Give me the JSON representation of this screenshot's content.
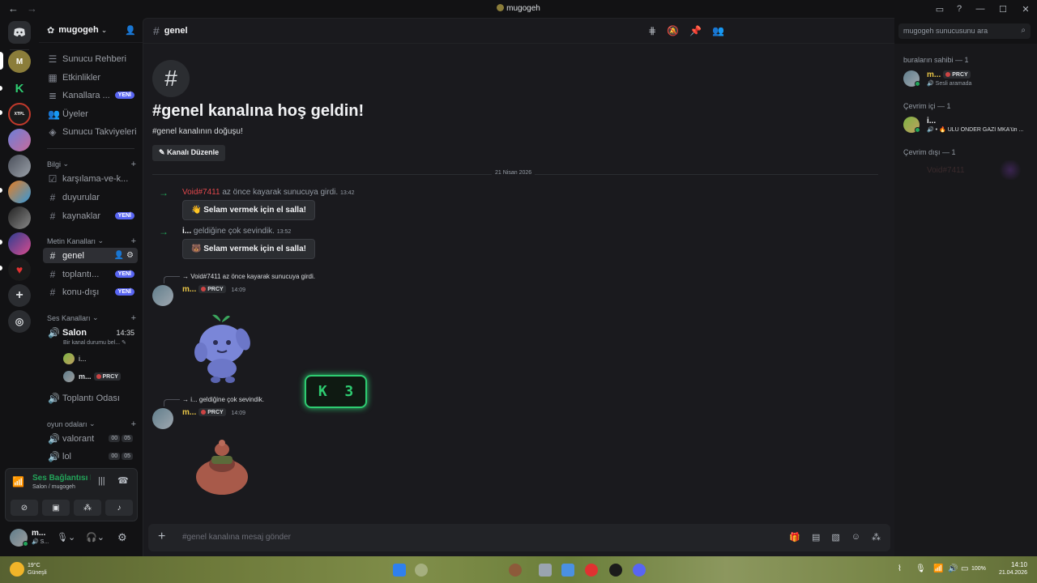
{
  "window": {
    "title": "mugogeh"
  },
  "server": {
    "name": "mugogeh"
  },
  "sidebar": {
    "top_items": [
      {
        "label": "Sunucu Rehberi"
      },
      {
        "label": "Etkinlikler"
      },
      {
        "label": "Kanallara ...",
        "badge": "YENİ"
      },
      {
        "label": "Üyeler"
      },
      {
        "label": "Sunucu Takviyeleri"
      }
    ],
    "categories": {
      "bilgi": "Bilgi",
      "metin": "Metin Kanalları",
      "ses": "Ses Kanalları",
      "oyun": "oyun odaları"
    },
    "bilgi_channels": [
      {
        "label": "karşılama-ve-k..."
      },
      {
        "label": "duyurular"
      },
      {
        "label": "kaynaklar",
        "badge": "YENİ"
      }
    ],
    "text_channels": [
      {
        "label": "genel"
      },
      {
        "label": "toplantı...",
        "badge": "YENİ"
      },
      {
        "label": "konu-dışı",
        "badge": "YENİ"
      }
    ],
    "voice": {
      "salon": "Salon",
      "salon_time": "14:35",
      "salon_status": "Bir kanal durumu bel...",
      "user1": "i...",
      "user2": "m...",
      "user2_tag": "PRCY",
      "toplanti": "Toplantı Odası"
    },
    "game_channels": [
      {
        "label": "valorant",
        "c1": "00",
        "c2": "05"
      },
      {
        "label": "lol",
        "c1": "00",
        "c2": "05"
      }
    ]
  },
  "voice_panel": {
    "status": "Ses Bağlantısı K",
    "sub": "Salon / mugogeh"
  },
  "user_panel": {
    "name": "m...",
    "status": "S..."
  },
  "channel": {
    "name": "genel",
    "search_placeholder": "mugogeh sunucusunu ara"
  },
  "welcome": {
    "title": "#genel kanalına hoş geldin!",
    "subtitle": "#genel kanalının doğuşu!",
    "edit_button": "Kanalı Düzenle"
  },
  "divider_date": "21 Nisan 2026",
  "messages": {
    "join1_user": "Void#7411",
    "join1_text": "az önce kayarak sunucuya girdi.",
    "join1_time": "13:42",
    "wave_button": "Selam vermek için el salla!",
    "join2_user": "i...",
    "join2_text": "geldiğine çok sevindik.",
    "join2_time": "13:52",
    "reply1": "Void#7411 az önce kayarak sunucuya girdi.",
    "reply2": "i... geldiğine çok sevindik.",
    "author": "m...",
    "author_tag": "PRCY",
    "time": "14:09",
    "kbadge": "K  3"
  },
  "composer": {
    "placeholder": "#genel kanalına mesaj gönder"
  },
  "members": {
    "owner_header": "buraların sahibi — 1",
    "owner_name": "m...",
    "owner_tag": "PRCY",
    "owner_status": "Sesli aramada",
    "online_header": "Çevrim içi — 1",
    "online_name": "i...",
    "online_status": "ULU ÖNDER GAZİ MKA'ün ...",
    "offline_header": "Çevrim dışı — 1",
    "offline_name": "Void#7411"
  },
  "taskbar": {
    "weather_temp": "19°C",
    "weather_desc": "Güneşli",
    "battery": "100%",
    "time": "14:10",
    "date": "21.04.2026"
  },
  "colors": {
    "accent": "#5865f2",
    "green": "#23a55a",
    "bg": "#1a1a1e"
  }
}
